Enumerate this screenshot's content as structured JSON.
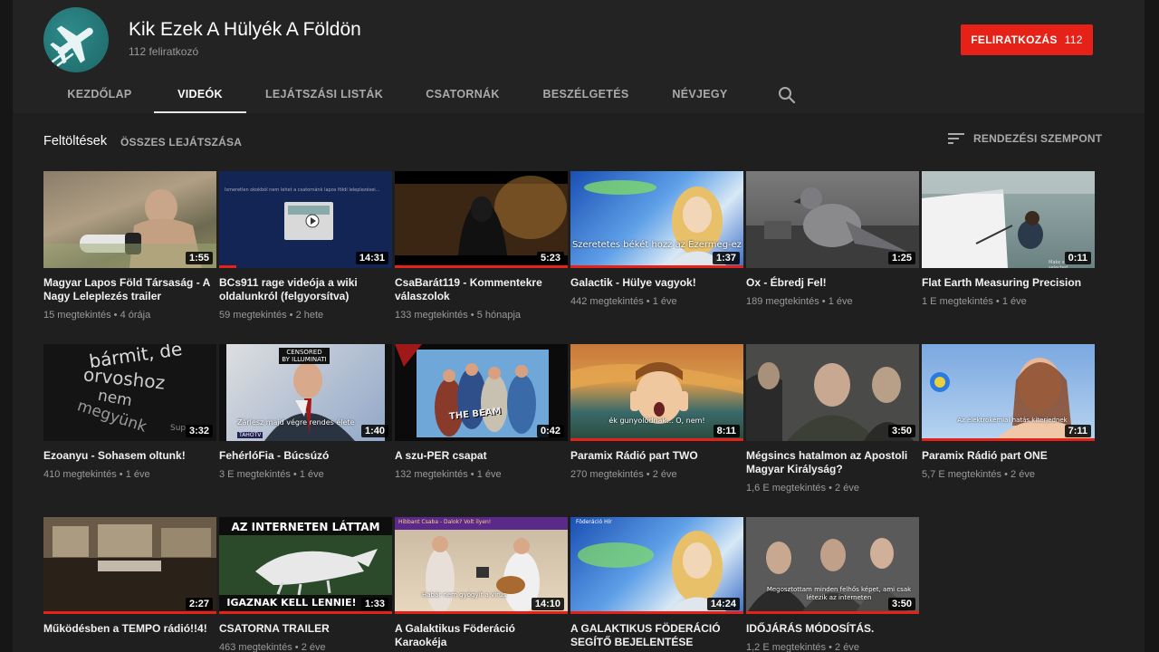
{
  "channel": {
    "name": "Kik Ezek A Hülyék A Földön",
    "subscribers": "112 feliratkozó",
    "subscribe_label": "FELIRATKOZÁS",
    "subscribe_count": "112",
    "avatar_icon": "airplane-icon"
  },
  "tabs": [
    {
      "label": "KEZDŐLAP",
      "active": false
    },
    {
      "label": "VIDEÓK",
      "active": true
    },
    {
      "label": "LEJÁTSZÁSI LISTÁK",
      "active": false
    },
    {
      "label": "CSATORNÁK",
      "active": false
    },
    {
      "label": "BESZÉLGETÉS",
      "active": false
    },
    {
      "label": "NÉVJEGY",
      "active": false
    }
  ],
  "section": {
    "title": "Feltöltések",
    "play_all": "ÖSSZES LEJÁTSZÁSA",
    "sort_label": "RENDEZÉSI SZEMPONT"
  },
  "videos": [
    {
      "title": "Magyar Lapos Föld Társaság - A Nagy Leleplezés trailer",
      "duration": "1:55",
      "views": "15 megtekintés",
      "age": "4 órája"
    },
    {
      "title": "BCs911 rage videója a wiki oldalunkról (felgyorsítva)",
      "duration": "14:31",
      "views": "59 megtekintés",
      "age": "2 hete",
      "progress": 0.1
    },
    {
      "title": "CsaBarát119 - Kommentekre válaszolok",
      "duration": "5:23",
      "views": "133 megtekintés",
      "age": "5 hónapja",
      "progress": 1.0
    },
    {
      "title": "Galactik - Hülye vagyok!",
      "duration": "1:37",
      "views": "442 megtekintés",
      "age": "1 éve",
      "progress": 1.0
    },
    {
      "title": "Ox - Ébredj Fel!",
      "duration": "1:25",
      "views": "189 megtekintés",
      "age": "1 éve"
    },
    {
      "title": "Flat Earth Measuring Precision",
      "duration": "0:11",
      "views": "1 E megtekintés",
      "age": "1 éve"
    },
    {
      "title": "Ezoanyu - Sohasem oltunk!",
      "duration": "3:32",
      "views": "410 megtekintés",
      "age": "1 éve"
    },
    {
      "title": "FehérlóFia - Búcsúzó",
      "duration": "1:40",
      "views": "3 E megtekintés",
      "age": "1 éve"
    },
    {
      "title": "A szu-PER csapat",
      "duration": "0:42",
      "views": "132 megtekintés",
      "age": "1 éve"
    },
    {
      "title": "Paramix Rádió part TWO",
      "duration": "8:11",
      "views": "270 megtekintés",
      "age": "2 éve",
      "progress": 1.0
    },
    {
      "title": "Mégsincs hatalmon az Apostoli Magyar Királyság?",
      "duration": "3:50",
      "views": "1,6 E megtekintés",
      "age": "2 éve"
    },
    {
      "title": "Paramix Rádió part ONE",
      "duration": "7:11",
      "views": "5,7 E megtekintés",
      "age": "2 éve",
      "progress": 1.0
    },
    {
      "title": "Működésben a TEMPO rádió!!4!",
      "duration": "2:27",
      "views": "",
      "age": "",
      "progress": 1.0
    },
    {
      "title": "CSATORNA TRAILER",
      "duration": "1:33",
      "views": "463 megtekintés",
      "age": "2 éve",
      "progress": 1.0
    },
    {
      "title": "A Galaktikus Föderáció Karaokéja",
      "duration": "14:10",
      "views": "",
      "age": "",
      "progress": 1.0
    },
    {
      "title": "A GALAKTIKUS FÖDERÁCIÓ SEGÍTŐ BEJELENTÉSE",
      "duration": "14:24",
      "views": "",
      "age": "",
      "progress": 1.0
    },
    {
      "title": "IDŐJÁRÁS MÓDOSÍTÁS.",
      "duration": "3:50",
      "views": "1,2 E megtekintés",
      "age": "2 éve",
      "progress": 1.0
    }
  ],
  "thumb_text": {
    "v2_caption": "Ismeretlen okokból nem lehet a csatornánk lapos földi leleplezései...",
    "v4_caption": "Szeretetes békét hozz az Ezermeg-ez",
    "v6_small": "Make sure video is selected",
    "v7_word1": "bármit, de",
    "v7_word2": "orvoshoz",
    "v7_word3": "nem",
    "v7_word4": "megyünk",
    "v7_word5": "Sup",
    "v8_banner": "CENSORED BY ILLUMINATI",
    "v8_caption": "Zárlesz majd végre rendes élete",
    "v8_logo": "TAHOTV",
    "v9_logo": "THE BEAM",
    "v10_caption": "ék gunyolódnak... O, nem!",
    "v12_caption": "Az elektrokémiai hatás kiterjednek",
    "v14_top": "AZ INTERNETEN LÁTTAM",
    "v14_bottom": "IGAZNAK KELL LENNIE!",
    "v15_banner": "Hibbant Csaba - Dalok? Volt ilyen!",
    "v15_caption": "Habár nem gyógyít a vírus",
    "v16_banner": "Föderáció Hír",
    "v17_caption": "Megosztottam minden felhős képet, ami csak létezik az interneten"
  },
  "colors": {
    "background": "#1f1f1f",
    "page_background": "#161616",
    "header": "#232323",
    "accent_red": "#e62117",
    "text_secondary": "#9a9a9a"
  }
}
